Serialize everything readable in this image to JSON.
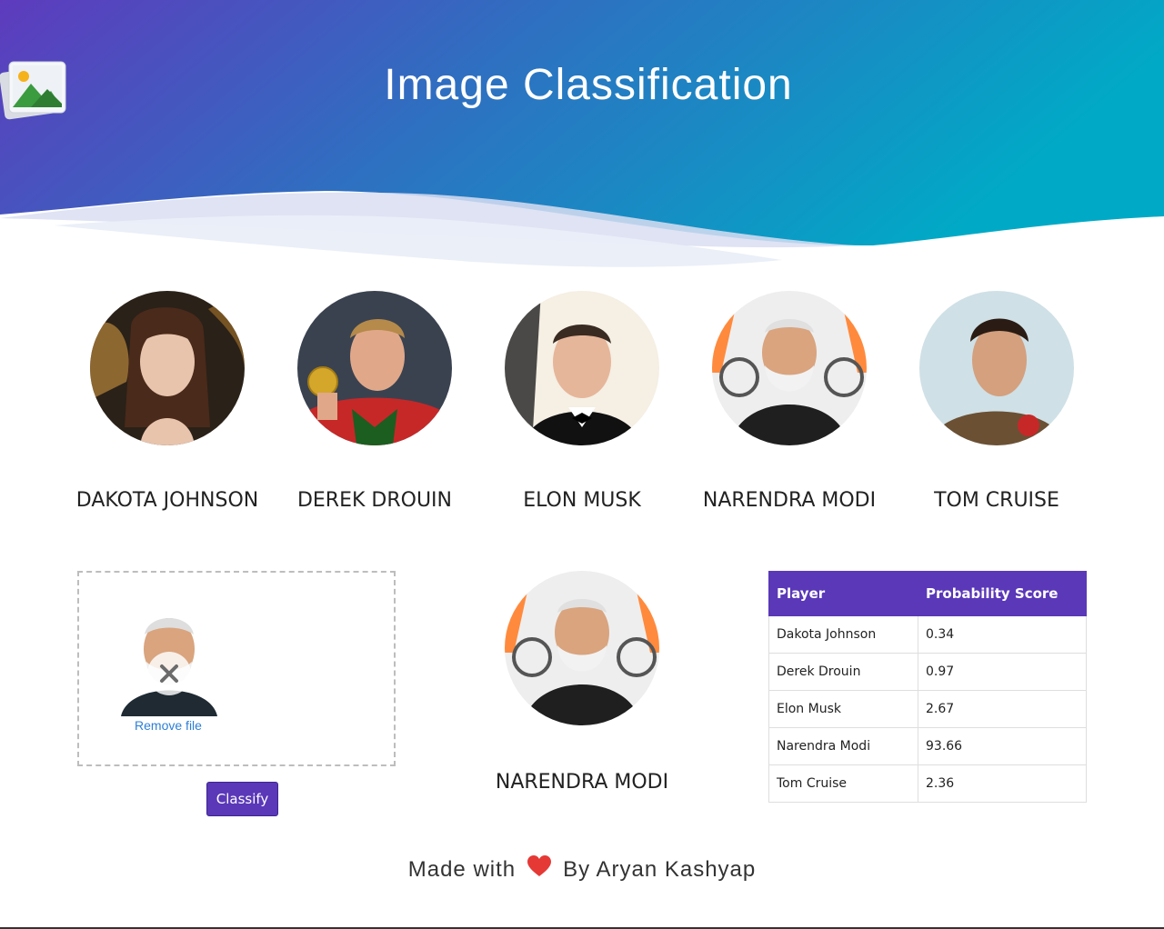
{
  "header": {
    "title": "Image Classification",
    "logo_icon": "image-gallery-icon",
    "gradient": [
      "#5e3bbd",
      "#2f6fc1",
      "#00aac6"
    ]
  },
  "celebrities": [
    {
      "name": "DAKOTA JOHNSON"
    },
    {
      "name": "DEREK DROUIN"
    },
    {
      "name": "ELON MUSK"
    },
    {
      "name": "NARENDRA MODI"
    },
    {
      "name": "TOM CRUISE"
    }
  ],
  "upload": {
    "remove_label": "Remove file",
    "classify_label": "Classify"
  },
  "result": {
    "name": "NARENDRA MODI"
  },
  "scores": {
    "headers": [
      "Player",
      "Probability Score"
    ],
    "rows": [
      [
        "Dakota Johnson",
        "0.34"
      ],
      [
        "Derek Drouin",
        "0.97"
      ],
      [
        "Elon Musk",
        "2.67"
      ],
      [
        "Narendra Modi",
        "93.66"
      ],
      [
        "Tom Cruise",
        "2.36"
      ]
    ]
  },
  "footer": {
    "made_with": "Made with",
    "by": "By Aryan Kashyap",
    "heart_color": "#e53935"
  },
  "colors": {
    "accent": "#5a38b8",
    "link": "#2d7fd6"
  }
}
